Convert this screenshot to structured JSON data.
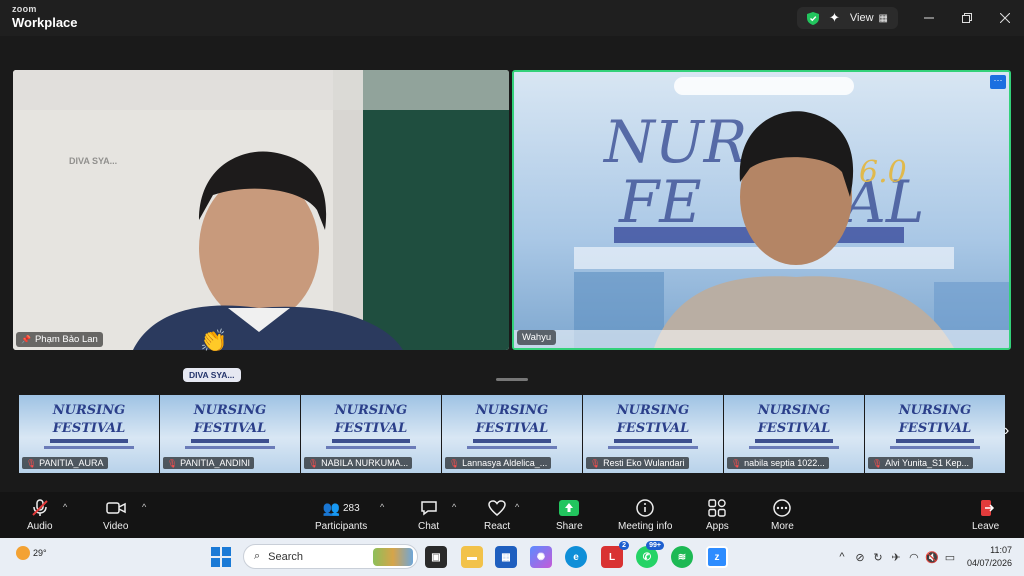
{
  "app": {
    "brand_top": "zoom",
    "brand_bottom": "Workplace"
  },
  "titlebar": {
    "view_label": "View"
  },
  "tiles": {
    "left": {
      "name": "Phạm Bảo Lan",
      "overlay_name": "DIVA SYA..."
    },
    "right": {
      "name": "Wahyu"
    }
  },
  "badge": {
    "label": "DIVA SYA..."
  },
  "thumbnails": [
    {
      "name": "PANITIA_AURA",
      "muted": true
    },
    {
      "name": "PANITIA_ANDINI",
      "muted": true
    },
    {
      "name": "NABILA NURKUMA...",
      "muted": true
    },
    {
      "name": "Lannasya Aldelica_...",
      "muted": true
    },
    {
      "name": "Resti Eko Wulandari",
      "muted": true
    },
    {
      "name": "nabila septia 1022...",
      "muted": true
    },
    {
      "name": "Alvi Yunita_S1 Kep...",
      "muted": true
    }
  ],
  "thumb_title": {
    "line1": "NURSING",
    "line2": "FESTIVAL"
  },
  "toolbar": {
    "audio": "Audio",
    "video": "Video",
    "participants": "Participants",
    "participants_count": "283",
    "chat": "Chat",
    "react": "React",
    "share": "Share",
    "meeting_info": "Meeting info",
    "apps": "Apps",
    "more": "More",
    "leave": "Leave"
  },
  "taskbar": {
    "temperature": "29°",
    "search_placeholder": "Search",
    "badge_red_app": "2",
    "badge_whatsapp": "99+",
    "time": "11:07",
    "date": "04/07/2026"
  },
  "colors": {
    "active_speaker": "#33d17a",
    "share_green": "#22c55e",
    "leave_red": "#e23b3b"
  }
}
